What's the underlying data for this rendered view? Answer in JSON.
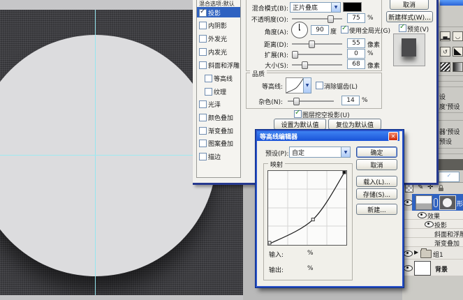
{
  "ls": {
    "list": {
      "header": "混合选项:默认",
      "items": [
        {
          "label": "投影",
          "checked": true,
          "selected": true
        },
        {
          "label": "内阴影",
          "checked": false
        },
        {
          "label": "外发光",
          "checked": false
        },
        {
          "label": "内发光",
          "checked": false
        },
        {
          "label": "斜面和浮雕",
          "checked": false
        },
        {
          "label": "等高线",
          "checked": false,
          "indent": true
        },
        {
          "label": "纹理",
          "checked": false,
          "indent": true
        },
        {
          "label": "光泽",
          "checked": false
        },
        {
          "label": "颜色叠加",
          "checked": false
        },
        {
          "label": "渐变叠加",
          "checked": false
        },
        {
          "label": "图案叠加",
          "checked": false
        },
        {
          "label": "描边",
          "checked": false
        }
      ]
    },
    "structure": {
      "blend_label": "混合模式(B):",
      "blend_value": "正片叠底",
      "blend_color": "#000000",
      "opacity_label": "不透明度(O):",
      "opacity_value": "75",
      "opacity_unit": "%",
      "angle_label": "角度(A):",
      "angle_value": "90",
      "angle_unit": "度",
      "global_label": "使用全局光(G)",
      "dist_label": "距离(D):",
      "dist_value": "55",
      "dist_unit": "像素",
      "spread_label": "扩展(R):",
      "spread_value": "0",
      "spread_unit": "%",
      "size_label": "大小(S):",
      "size_value": "68",
      "size_unit": "像素"
    },
    "quality": {
      "legend": "品质",
      "contour_label": "等高线:",
      "aa_label": "消除锯齿(L)",
      "noise_label": "杂色(N):",
      "noise_value": "14",
      "noise_unit": "%",
      "knockout_label": "图层挖空投影(U)"
    },
    "footer": {
      "set_default": "设置为默认值",
      "reset_default": "复位为默认值"
    },
    "right": {
      "cancel": "取消",
      "new_style": "新建样式(W)...",
      "preview": "预览(V)"
    },
    "selection_color": "#2f62c1"
  },
  "ce": {
    "title": "等高线编辑器",
    "preset_label": "预设(P):",
    "preset_value": "自定",
    "map_legend": "映射",
    "input_label": "输入:",
    "input_unit": "%",
    "output_label": "输出:",
    "output_unit": "%",
    "btn_ok": "确定",
    "btn_cancel": "取消",
    "btn_load": "载入(L)...",
    "btn_save": "存储(S)...",
    "btn_new": "新建...",
    "curve_points": [
      [
        0,
        0
      ],
      [
        58,
        34
      ],
      [
        100,
        100
      ]
    ]
  },
  "dock": {
    "labels": [
      "设",
      "度'预设",
      "器'预设",
      "预设"
    ],
    "layers": {
      "shape": "形状",
      "effects": "效果",
      "drop_shadow": "投影",
      "bevel": "斜面和浮雕",
      "gradient": "渐变叠加",
      "group": "组1",
      "background": "背景"
    }
  },
  "canvas": {
    "guide_color": "#96e6ef",
    "circle_color": "#dcdcde"
  }
}
